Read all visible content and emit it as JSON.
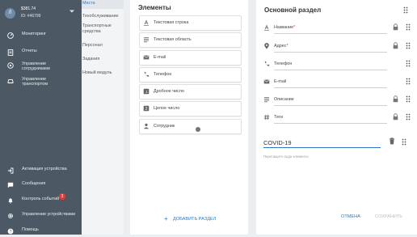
{
  "account": {
    "avatar_letter": "Л",
    "name": "$381.74",
    "id": "ID: #46799"
  },
  "sidebar": {
    "items": [
      {
        "label": "Мониторинг",
        "icon": "dashboard-icon"
      },
      {
        "label": "Отчеты",
        "icon": "document-icon"
      },
      {
        "label": "Управление\nсотрудниками",
        "icon": "location-icon"
      },
      {
        "label": "Управление\nтранспортом",
        "icon": "car-icon"
      },
      {
        "label": "Активация устройства",
        "icon": "login-icon"
      },
      {
        "label": "Сообщения",
        "icon": "chat-icon"
      },
      {
        "label": "Контроль событий",
        "icon": "bell-icon",
        "badge": "3"
      },
      {
        "label": "Управление устройствами",
        "icon": "gear-icon"
      },
      {
        "label": "Помощь",
        "icon": "help-icon"
      }
    ]
  },
  "subnav": {
    "items": [
      {
        "label": "Места",
        "active": true
      },
      {
        "label": "Техобслуживание",
        "active": false
      },
      {
        "label": "Транспортные средства",
        "active": false
      },
      {
        "label": "Персонал",
        "active": false
      },
      {
        "label": "Задания",
        "active": false
      },
      {
        "label": "Новый модуль",
        "active": false
      }
    ]
  },
  "elements_panel": {
    "title": "Элементы",
    "items": [
      {
        "label": "Текстовая строка",
        "icon": "text-line-icon"
      },
      {
        "label": "Текстовая область",
        "icon": "text-area-icon"
      },
      {
        "label": "E-mail",
        "icon": "mail-icon"
      },
      {
        "label": "Телефон",
        "icon": "phone-icon"
      },
      {
        "label": "Дробное число",
        "icon": "decimal-icon"
      },
      {
        "label": "Целое число",
        "icon": "integer-icon"
      },
      {
        "label": "Сотрудник",
        "icon": "person-icon"
      }
    ],
    "add_section_label": "ДОБАВИТЬ РАЗДЕЛ"
  },
  "main_section": {
    "title": "Основной раздел",
    "fields": [
      {
        "label": "Название",
        "required": "*",
        "icon": "text-line-icon",
        "locked": true
      },
      {
        "label": "Адрес",
        "required": "*",
        "icon": "location-pin-icon",
        "locked": true
      },
      {
        "label": "Телефон",
        "required": "",
        "icon": "phone-icon",
        "locked": false
      },
      {
        "label": "E-mail",
        "required": "",
        "icon": "mail-icon",
        "locked": false
      },
      {
        "label": "Описание",
        "required": "",
        "icon": "text-area-icon",
        "locked": true
      },
      {
        "label": "Теги",
        "required": "",
        "icon": "hash-icon",
        "locked": true
      }
    ],
    "new_section_value": "COVID-19",
    "drop_hint": "Перетащите сюда элементы",
    "cancel_label": "ОТМЕНА",
    "save_label": "СОХРАНИТЬ"
  },
  "colors": {
    "sidebar_bg": "#4c5965",
    "accent": "#2f78c4",
    "badge": "#e53935"
  }
}
